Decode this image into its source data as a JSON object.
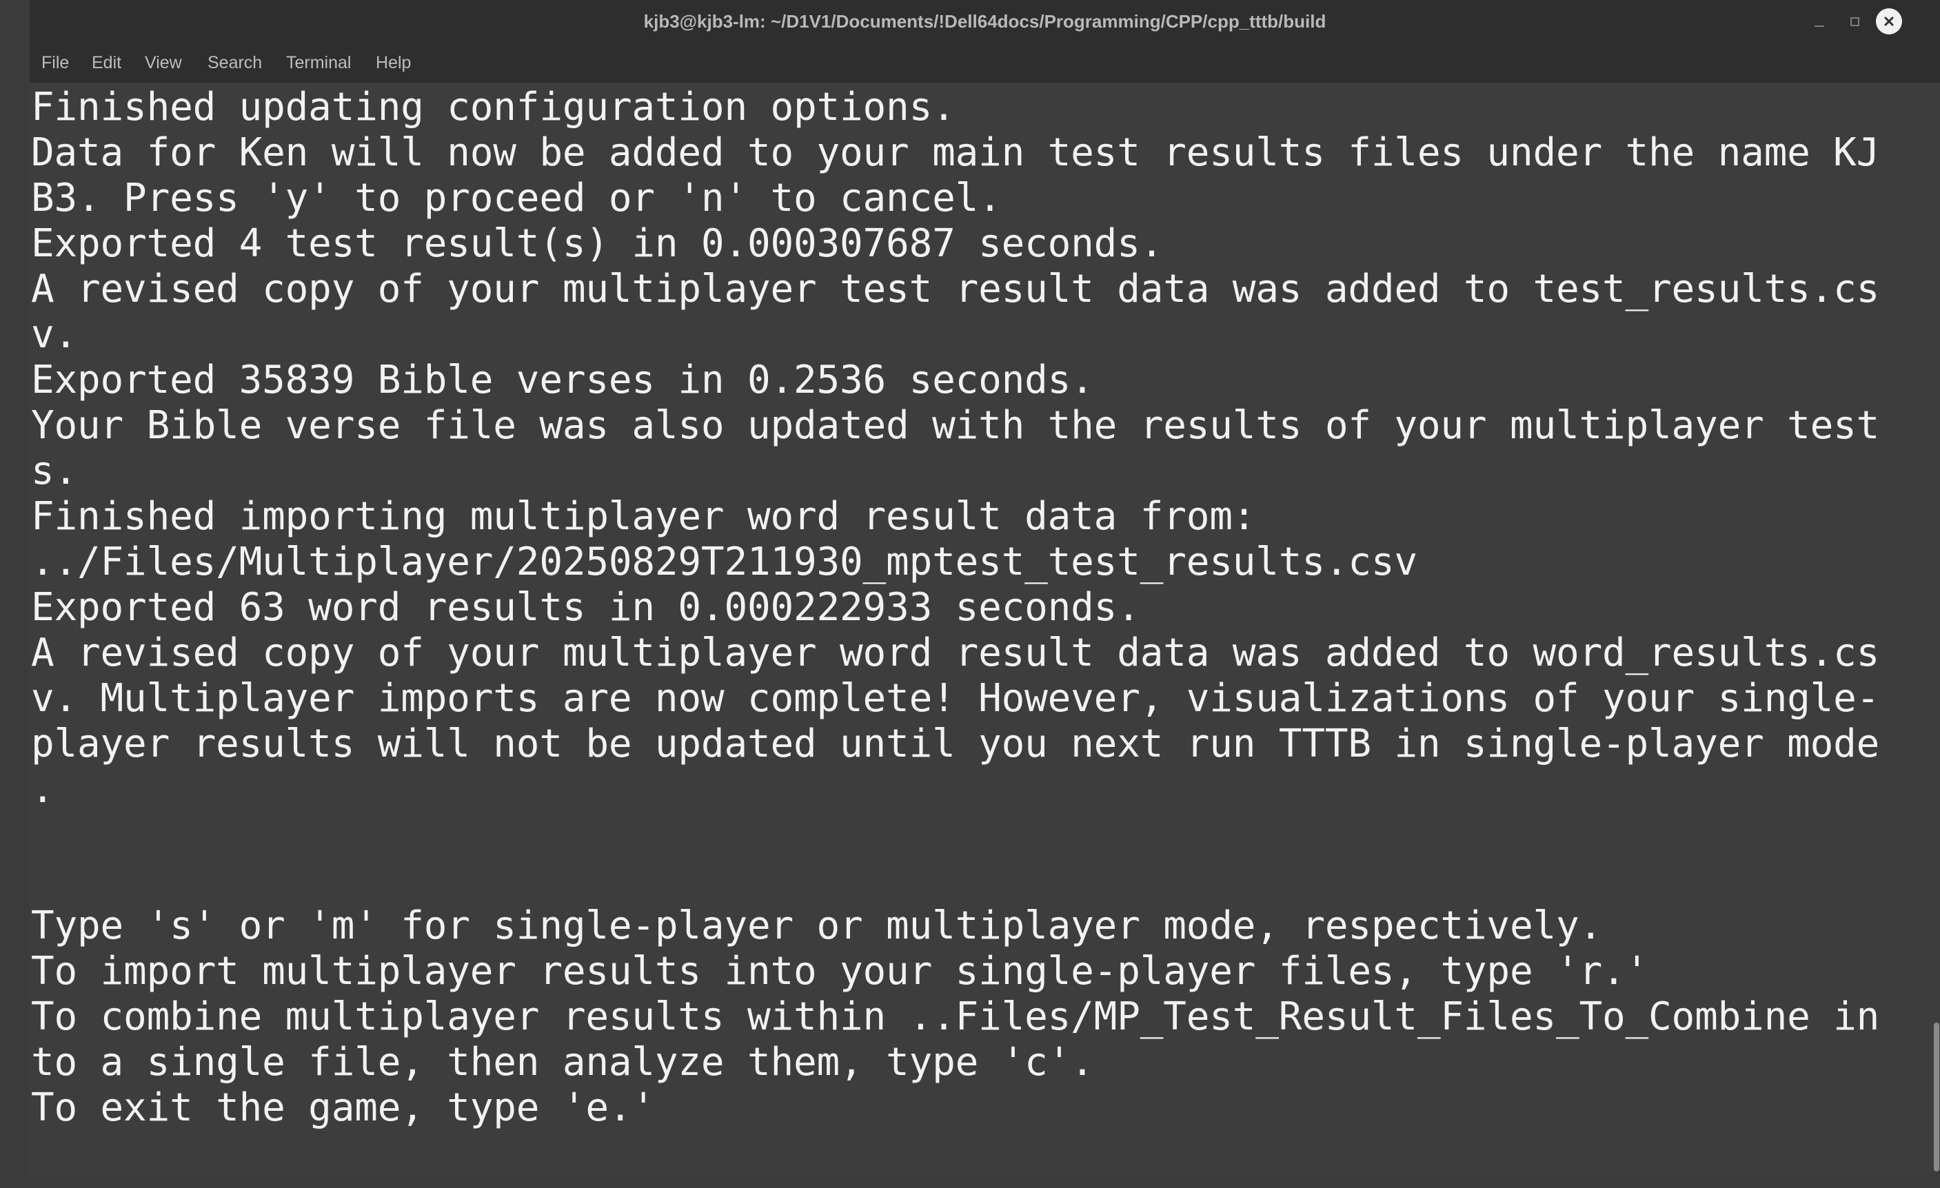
{
  "window": {
    "title": "kjb3@kjb3-lm: ~/D1V1/Documents/!Dell64docs/Programming/CPP/cpp_tttb/build"
  },
  "window_controls": {
    "minimize_icon": "minimize-icon",
    "maximize_icon": "maximize-icon",
    "close_icon": "close-icon"
  },
  "menu": [
    {
      "label": "File"
    },
    {
      "label": "Edit"
    },
    {
      "label": "View"
    },
    {
      "label": "Search"
    },
    {
      "label": "Terminal"
    },
    {
      "label": "Help"
    }
  ],
  "terminal": {
    "lines": [
      "Finished updating configuration options.",
      "Data for Ken will now be added to your main test results files under the name KJ",
      "B3. Press 'y' to proceed or 'n' to cancel.",
      "Exported 4 test result(s) in 0.000307687 seconds.",
      "A revised copy of your multiplayer test result data was added to test_results.cs",
      "v.",
      "Exported 35839 Bible verses in 0.2536 seconds.",
      "Your Bible verse file was also updated with the results of your multiplayer test",
      "s.",
      "Finished importing multiplayer word result data from:",
      "../Files/Multiplayer/20250829T211930_mptest_test_results.csv",
      "Exported 63 word results in 0.000222933 seconds.",
      "A revised copy of your multiplayer word result data was added to word_results.cs",
      "v. Multiplayer imports are now complete! However, visualizations of your single-",
      "player results will not be updated until you next run TTTB in single-player mode",
      ".",
      "",
      "",
      "Type 's' or 'm' for single-player or multiplayer mode, respectively.",
      "To import multiplayer results into your single-player files, type 'r.'",
      "To combine multiplayer results within ..Files/MP_Test_Result_Files_To_Combine in",
      "to a single file, then analyze them, type 'c'.",
      "To exit the game, type 'e.'"
    ]
  },
  "colors": {
    "titlebar": "#2e2e2e",
    "terminal_bg": "#3d3d3d",
    "terminal_text": "#f2f2f2"
  }
}
